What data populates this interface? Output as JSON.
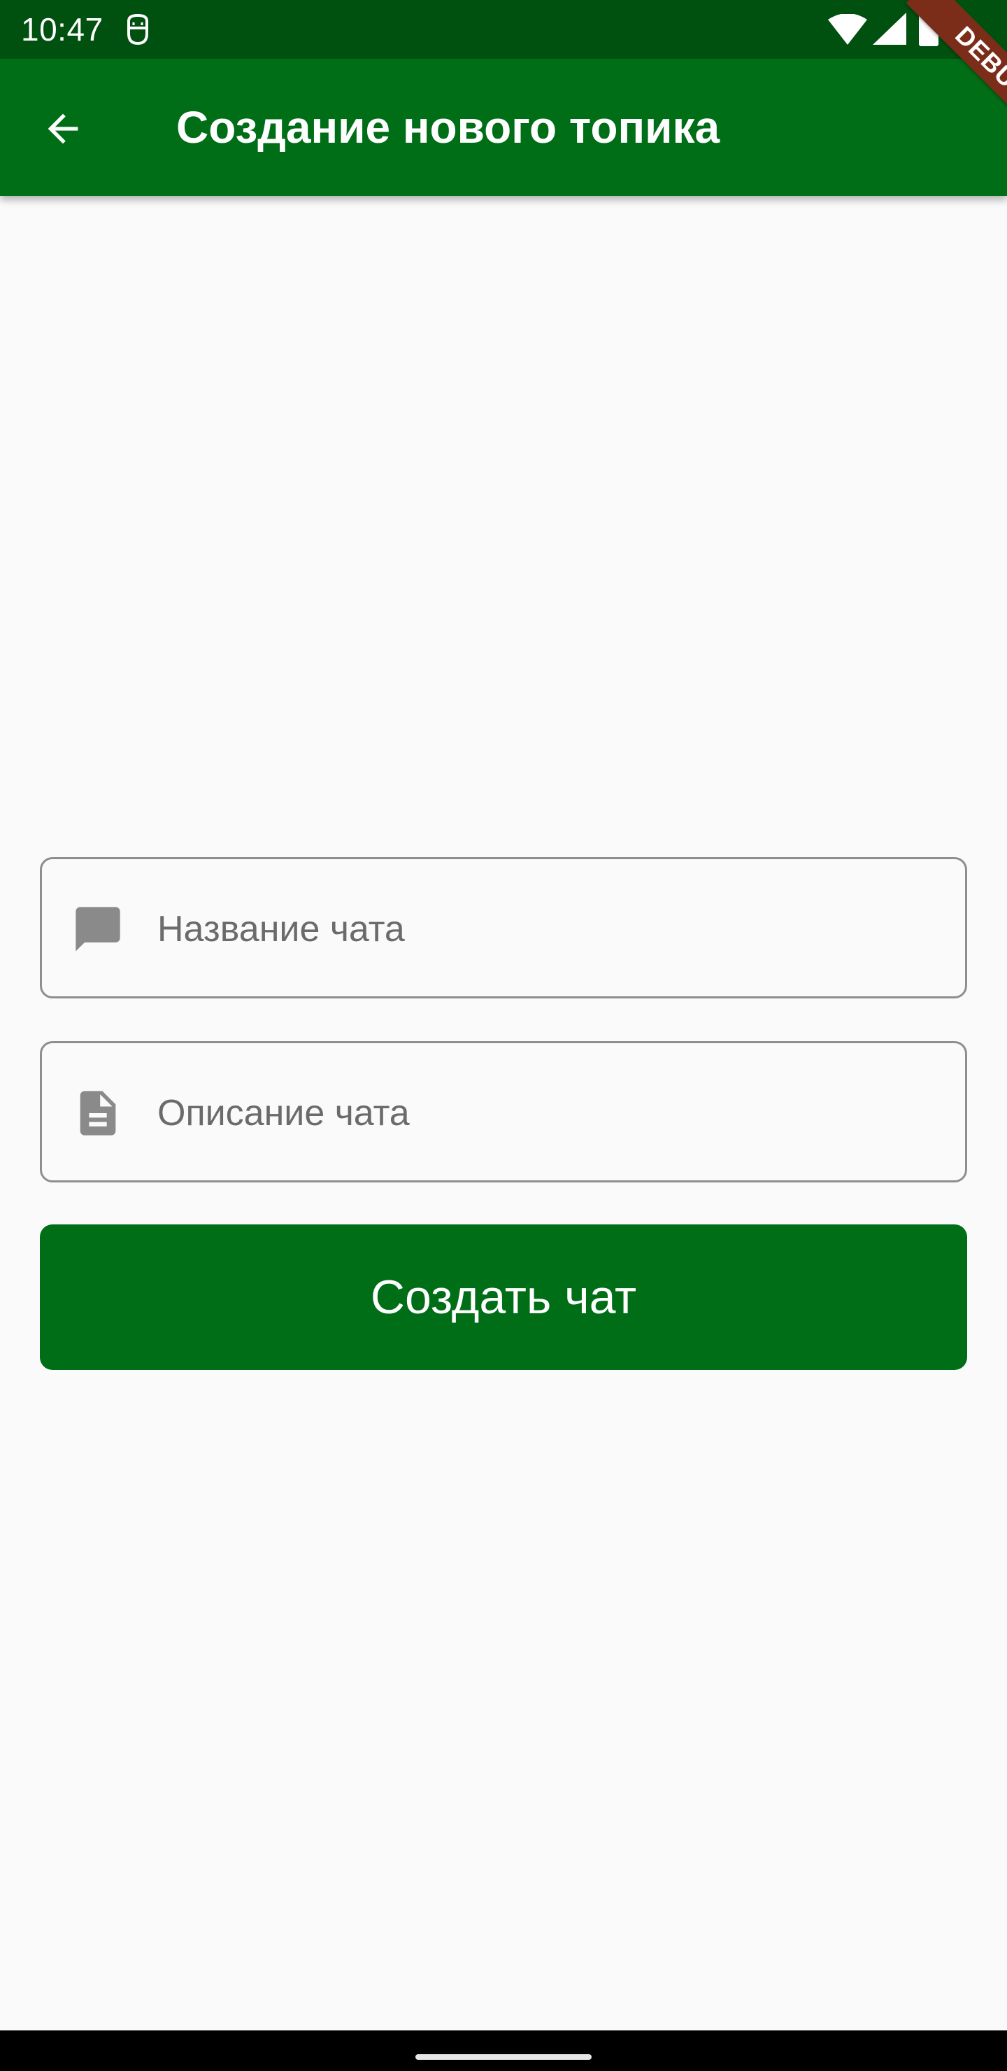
{
  "status_bar": {
    "time": "10:47",
    "icons": [
      "notification-face-icon",
      "wifi-icon",
      "signal-icon",
      "battery-icon"
    ],
    "background": "#00510f"
  },
  "app_bar": {
    "title": "Создание нового топика",
    "back_icon": "arrow-back-icon",
    "background": "#006e16"
  },
  "debug_banner": {
    "label": "DEBUG"
  },
  "form": {
    "chat_name": {
      "value": "",
      "placeholder": "Название чата",
      "icon": "chat-bubble-icon"
    },
    "chat_description": {
      "value": "",
      "placeholder": "Описание чата",
      "icon": "document-icon"
    },
    "create_button_label": "Создать чат",
    "accent": "#006e16"
  },
  "nav_bar": {
    "home_indicator": "home-gesture-bar"
  }
}
